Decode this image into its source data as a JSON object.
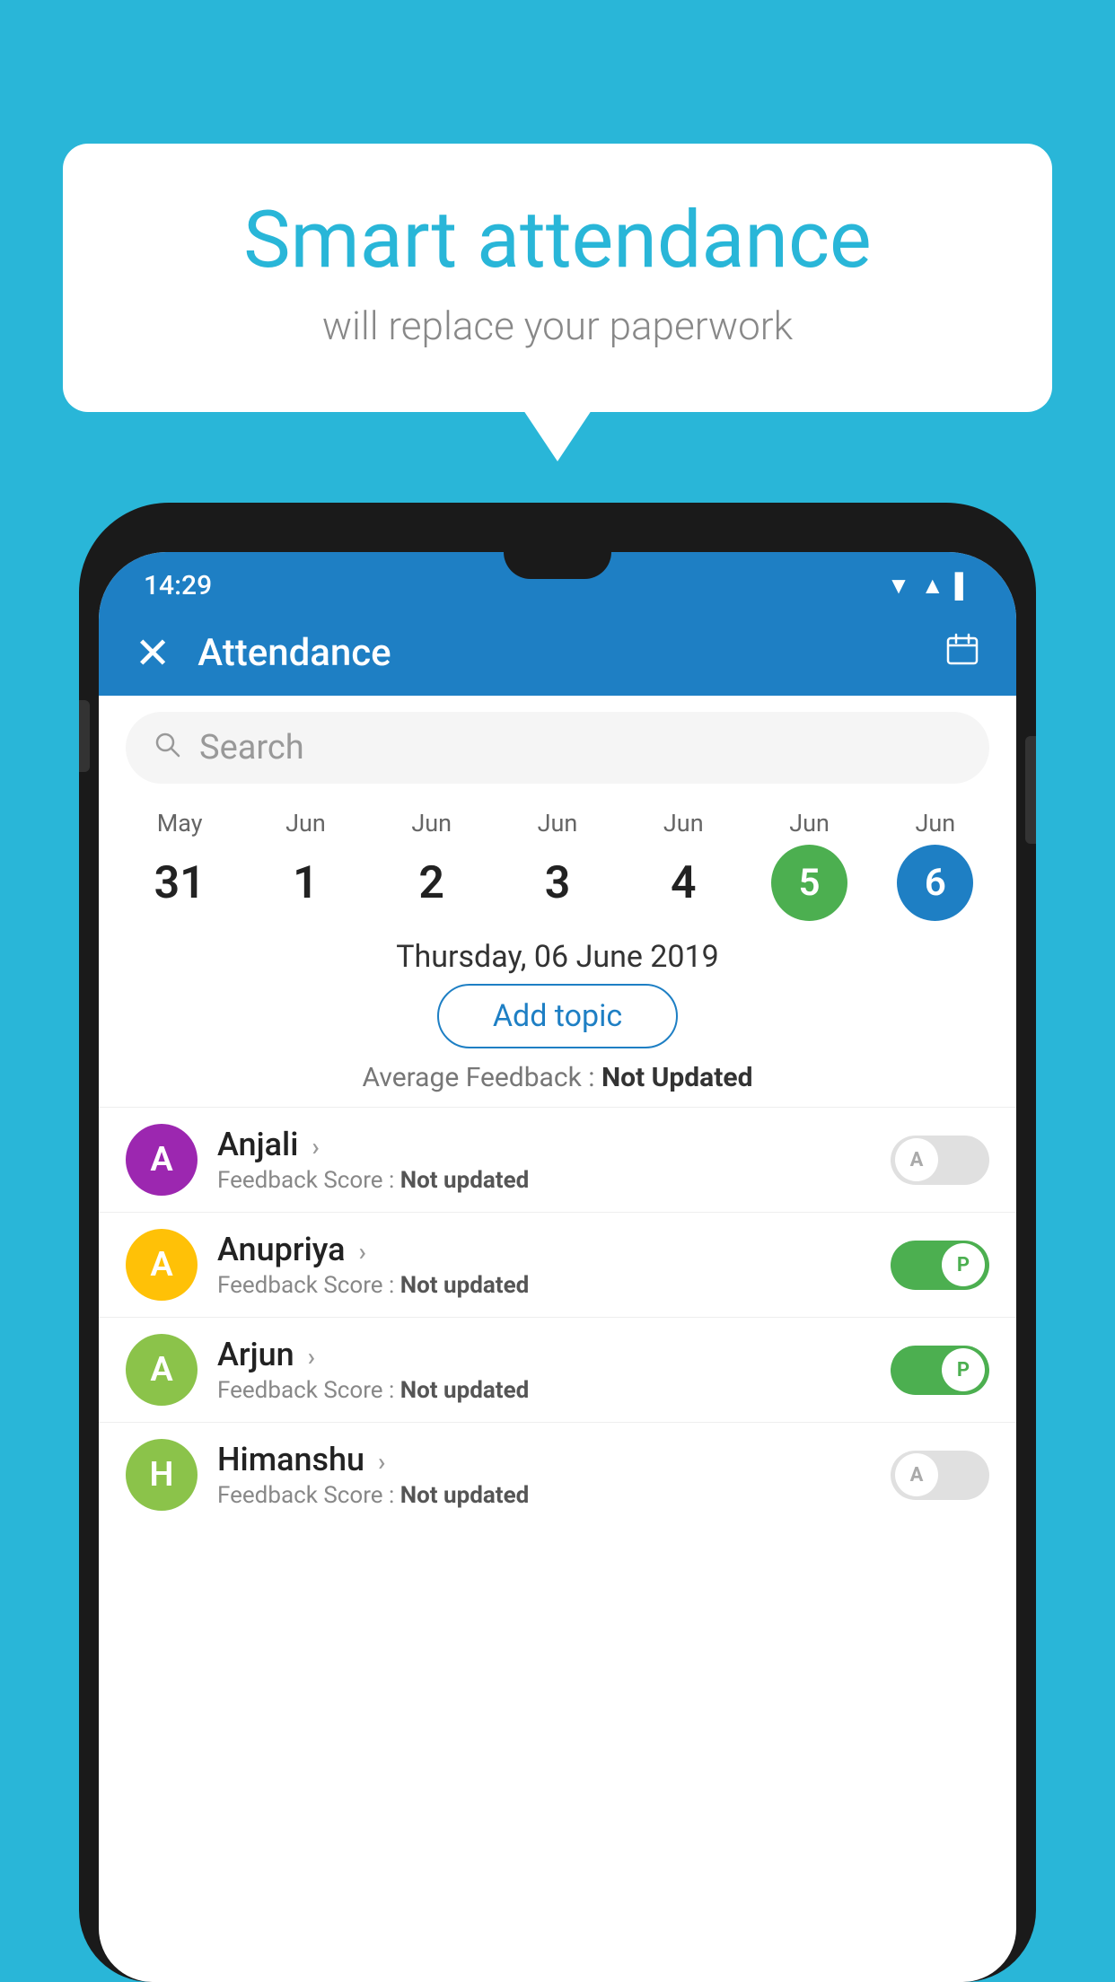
{
  "background_color": "#29b6d8",
  "speech_bubble": {
    "title": "Smart attendance",
    "subtitle": "will replace your paperwork"
  },
  "status_bar": {
    "time": "14:29"
  },
  "app_bar": {
    "title": "Attendance",
    "close_label": "×",
    "calendar_label": "📅"
  },
  "search": {
    "placeholder": "Search"
  },
  "calendar": {
    "days": [
      {
        "month": "May",
        "date": "31",
        "style": "normal"
      },
      {
        "month": "Jun",
        "date": "1",
        "style": "normal"
      },
      {
        "month": "Jun",
        "date": "2",
        "style": "normal"
      },
      {
        "month": "Jun",
        "date": "3",
        "style": "normal"
      },
      {
        "month": "Jun",
        "date": "4",
        "style": "normal"
      },
      {
        "month": "Jun",
        "date": "5",
        "style": "today"
      },
      {
        "month": "Jun",
        "date": "6",
        "style": "selected"
      }
    ]
  },
  "selected_date": "Thursday, 06 June 2019",
  "add_topic_label": "Add topic",
  "avg_feedback_label": "Average Feedback : ",
  "avg_feedback_value": "Not Updated",
  "students": [
    {
      "name": "Anjali",
      "initial": "A",
      "avatar_color": "#9c27b0",
      "score_label": "Feedback Score : ",
      "score_value": "Not updated",
      "attendance": "absent"
    },
    {
      "name": "Anupriya",
      "initial": "A",
      "avatar_color": "#ffc107",
      "score_label": "Feedback Score : ",
      "score_value": "Not updated",
      "attendance": "present"
    },
    {
      "name": "Arjun",
      "initial": "A",
      "avatar_color": "#8bc34a",
      "score_label": "Feedback Score : ",
      "score_value": "Not updated",
      "attendance": "present"
    },
    {
      "name": "Himanshu",
      "initial": "H",
      "avatar_color": "#8bc34a",
      "score_label": "Feedback Score : ",
      "score_value": "Not updated",
      "attendance": "absent"
    }
  ]
}
